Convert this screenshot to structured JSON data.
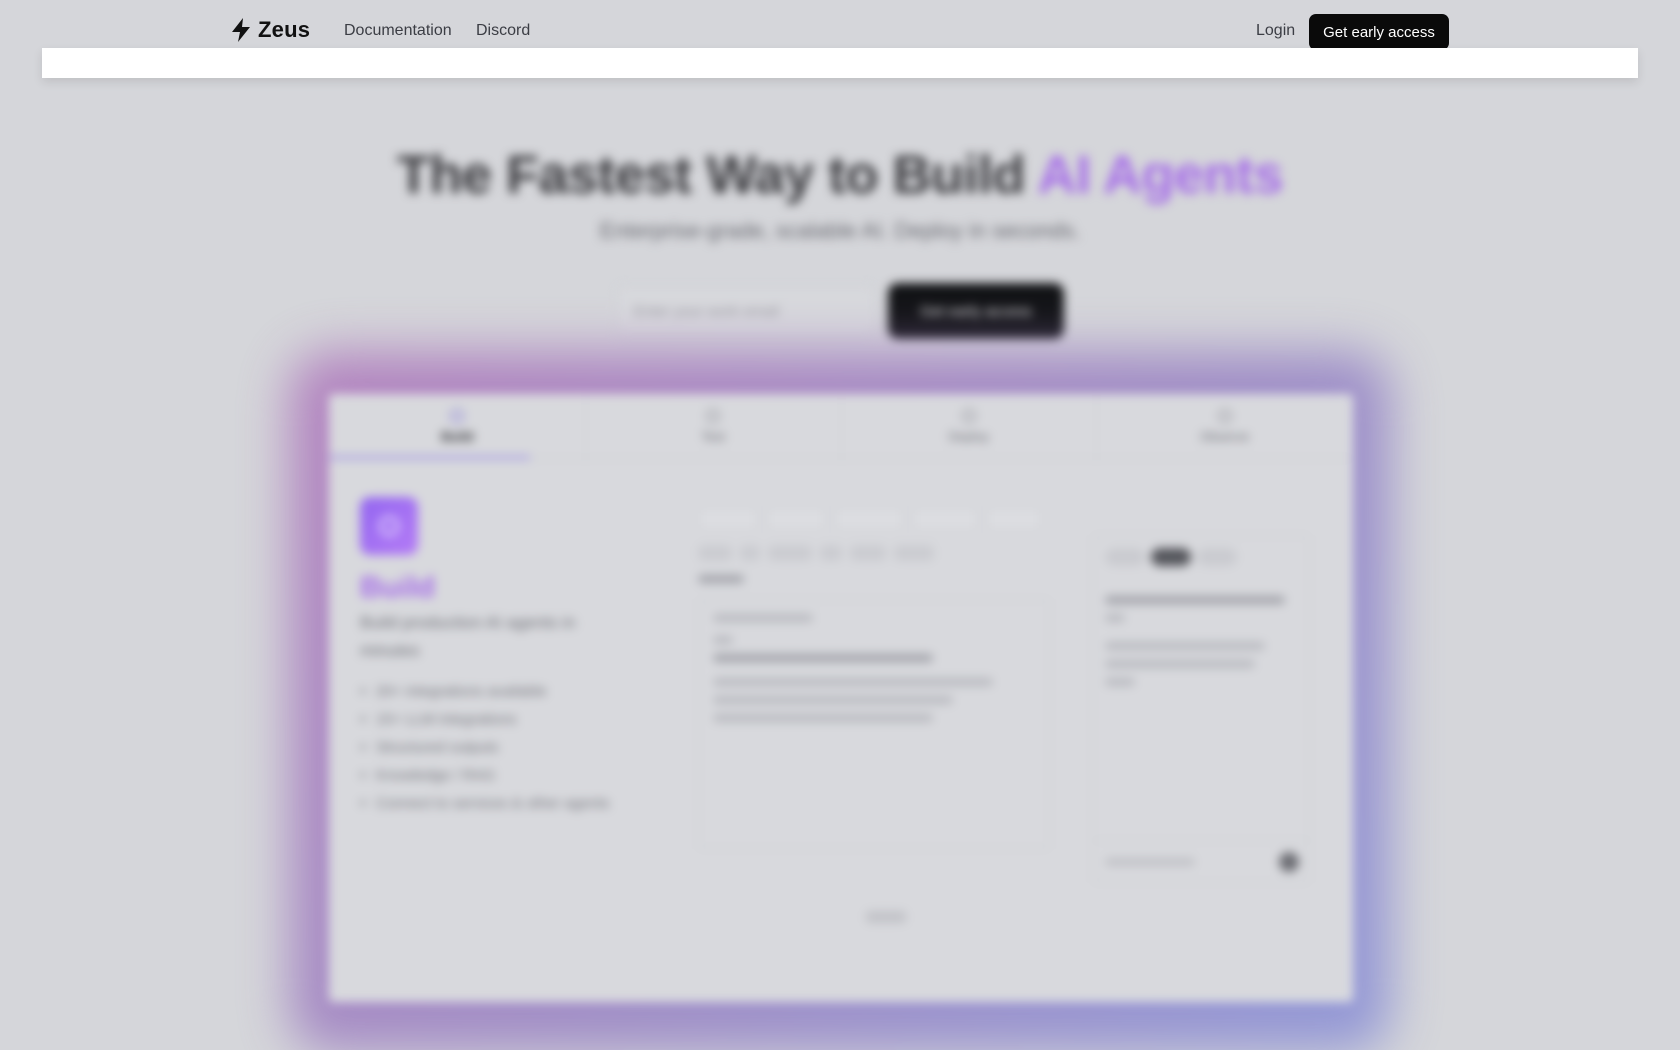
{
  "nav": {
    "brand": "Zeus",
    "links": [
      "Documentation",
      "Discord"
    ],
    "login": "Login",
    "cta": "Get early access"
  },
  "hero": {
    "title_main": "The Fastest Way to Build ",
    "title_accent": "AI Agents",
    "subtitle": "Enterprise-grade, scalable AI. Deploy in seconds.",
    "email_placeholder": "Enter your work email",
    "button": "Get early access"
  },
  "preview": {
    "tabs": [
      "Build",
      "Test",
      "Deploy",
      "Observe"
    ],
    "active_tab": "Build",
    "feature_title": "Build",
    "feature_desc": "Build production AI agents in minutes",
    "features": [
      "20+ integrations available",
      "15+ LLM integrations",
      "Structured outputs",
      "Knowledge / RAG",
      "Connect to services & other agents"
    ]
  },
  "colors": {
    "accent": "#a56ce8",
    "dark_button": "#0a0a0a",
    "background": "#d5d6da"
  }
}
